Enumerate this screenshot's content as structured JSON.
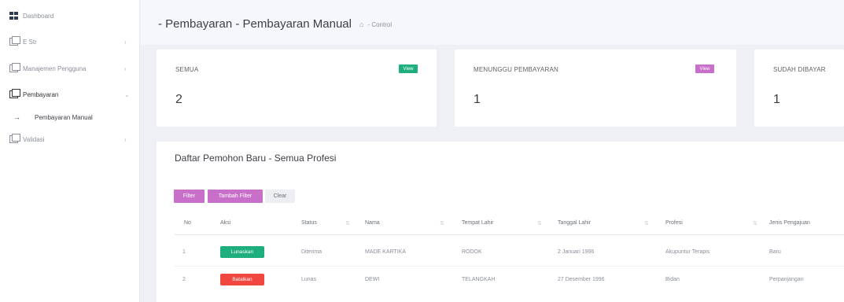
{
  "sidebar": {
    "items": [
      {
        "label": "Dashboard"
      },
      {
        "label": "E Str"
      },
      {
        "label": "Manajemen Pengguna"
      },
      {
        "label": "Pembayaran"
      },
      {
        "label": "Pembayaran Manual"
      },
      {
        "label": "Validasi"
      }
    ]
  },
  "header": {
    "title": "- Pembayaran - Pembayaran Manual",
    "breadcrumb": "- Control"
  },
  "cards": [
    {
      "title": "SEMUA",
      "value": "2",
      "button": "View",
      "button_color": "#1fae7e"
    },
    {
      "title": "MENUNGGU PEMBAYARAN",
      "value": "1",
      "button": "View",
      "button_color": "#c86fc9"
    },
    {
      "title": "SUDAH DIBAYAR",
      "value": "1"
    }
  ],
  "panel": {
    "title": "Daftar Pemohon Baru - Semua Profesi",
    "filter_buttons": [
      "Filter",
      "Tambah Filter",
      "Clear"
    ],
    "columns": [
      "No",
      "Aksi",
      "Status",
      "Nama",
      "Tempat Lahir",
      "Tanggal Lahir",
      "Profesi",
      "Jenis Pengajuan"
    ],
    "rows": [
      {
        "no": "1",
        "action": "Lunaskan",
        "action_color": "#1fae7e",
        "status": "Diterima",
        "nama": "MADE KARTIKA",
        "tempat": "RODOK",
        "tanggal": "2 Januari 1996",
        "profesi": "Akupuntur Terapis",
        "jenis": "Baru"
      },
      {
        "no": "2",
        "action": "Batalkan",
        "action_color": "#f0473f",
        "status": "Lunas",
        "nama": "DEWI",
        "tempat": "TELANGKAH",
        "tanggal": "27 Desember 1996",
        "profesi": "Bidan",
        "jenis": "Perpanjangan"
      }
    ]
  },
  "colors": {
    "accent_purple": "#c86fc9",
    "success": "#1fae7e",
    "danger": "#f0473f"
  }
}
